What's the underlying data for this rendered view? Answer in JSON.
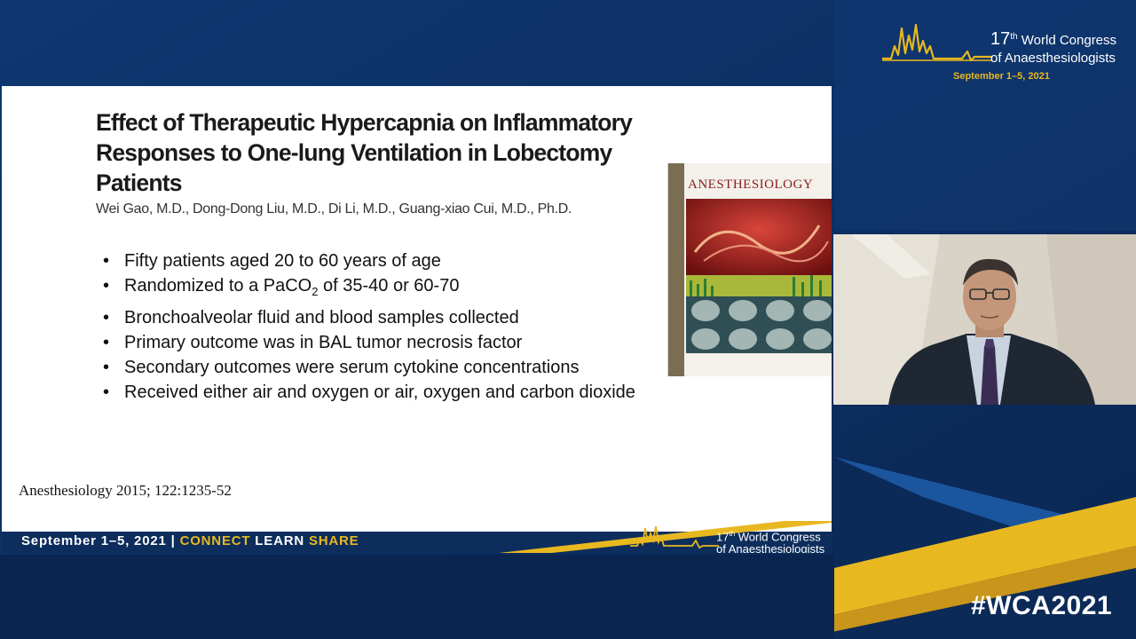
{
  "event": {
    "number": "17",
    "ordinal": "th",
    "name_line1": "World Congress",
    "name_line2": "of Anaesthesiologists",
    "dates": "September 1–5, 2021",
    "hashtag": "#WCA2021"
  },
  "slide": {
    "title_line1": "Effect of Therapeutic Hypercapnia on Inflammatory",
    "title_line2": "Responses to One-lung Ventilation in Lobectomy Patients",
    "authors": "Wei Gao, M.D., Dong-Dong Liu, M.D., Di Li, M.D., Guang-xiao Cui, M.D., Ph.D.",
    "bullets": {
      "b1": "Fifty patients aged 20 to 60 years of age",
      "b2_pre": "Randomized to a PaCO",
      "b2_sub": "2",
      "b2_post": " of 35-40 or 60-70",
      "b3": "Bronchoalveolar fluid and blood samples collected",
      "b4": "Primary outcome was in BAL tumor necrosis factor",
      "b5": "Secondary outcomes were serum cytokine concentrations",
      "b6": "Received either air and oxygen or air, oxygen and carbon dioxide"
    },
    "citation": "Anesthesiology 2015; 122:1235-52",
    "journal_cover_title": "ANESTHESIOLOGY",
    "footer": {
      "dates": "September 1–5, 2021",
      "separator": " | ",
      "connect": "CONNECT",
      "learn": " LEARN ",
      "share": "SHARE"
    }
  },
  "colors": {
    "navy": "#0d2d5c",
    "gold": "#e8b820",
    "light_blue": "#1c5aa6"
  }
}
